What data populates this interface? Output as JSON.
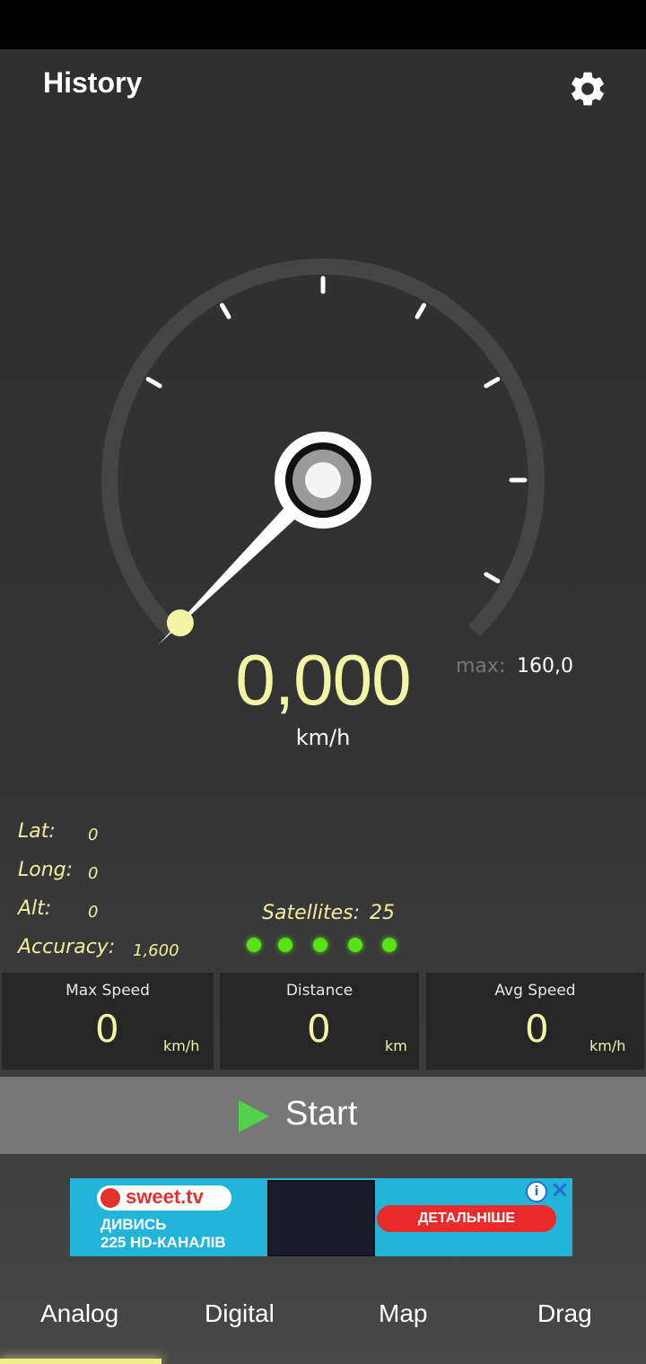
{
  "header": {
    "title": "History",
    "settings_icon": "gear-icon"
  },
  "gauge": {
    "speed_value": "0,000",
    "speed_unit": "km/h",
    "max_label": "max:",
    "max_value": "160,0",
    "needle_fraction": 0,
    "accent_color": "#f2f5a6"
  },
  "gps": {
    "lat_label": "Lat:",
    "lat_value": "0",
    "long_label": "Long:",
    "long_value": "0",
    "alt_label": "Alt:",
    "alt_value": "0",
    "accuracy_label": "Accuracy:",
    "accuracy_value": "1,600"
  },
  "satellites": {
    "label": "Satellites:",
    "count": "25",
    "indicator_color": "#58e316"
  },
  "stats": [
    {
      "title": "Max Speed",
      "value": "0",
      "unit": "km/h"
    },
    {
      "title": "Distance",
      "value": "0",
      "unit": "km"
    },
    {
      "title": "Avg Speed",
      "value": "0",
      "unit": "km/h"
    }
  ],
  "start_button": {
    "label": "Start",
    "icon": "play-icon",
    "icon_color": "#52d24a"
  },
  "ad": {
    "brand": "sweet.tv",
    "line1": "ДИВИСЬ",
    "line2": "225 HD-КАНАЛІВ",
    "cta": "ДЕТАЛЬНІШЕ",
    "info_icon": "info-icon",
    "close_icon": "close-icon"
  },
  "tabs": [
    {
      "label": "Analog",
      "active": true
    },
    {
      "label": "Digital",
      "active": false
    },
    {
      "label": "Map",
      "active": false
    },
    {
      "label": "Drag",
      "active": false
    }
  ]
}
